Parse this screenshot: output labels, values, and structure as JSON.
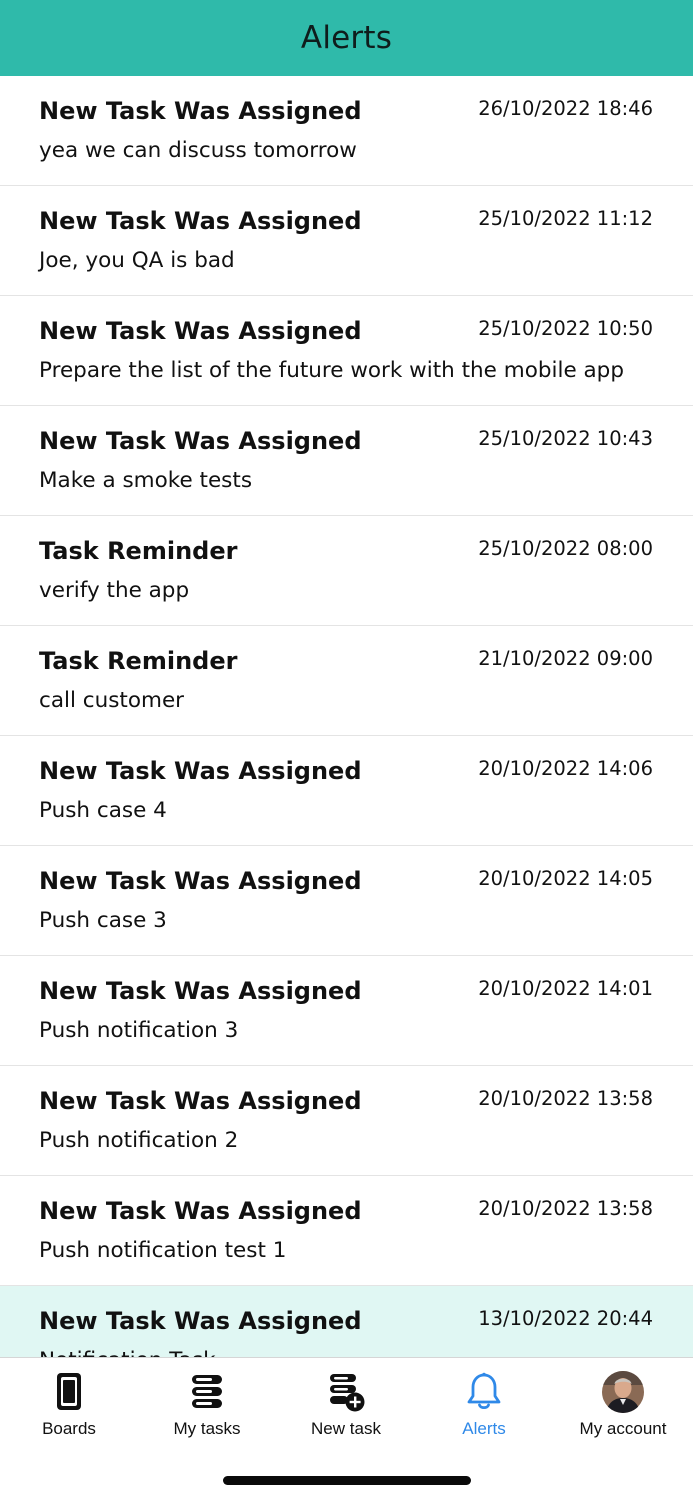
{
  "header": {
    "title": "Alerts"
  },
  "alerts": [
    {
      "title": "New Task Was Assigned",
      "time": "26/10/2022 18:46",
      "body": "yea we can discuss tomorrow"
    },
    {
      "title": "New Task Was Assigned",
      "time": "25/10/2022 11:12",
      "body": "Joe, you QA is bad"
    },
    {
      "title": "New Task Was Assigned",
      "time": "25/10/2022 10:50",
      "body": "Prepare the list of the future work with the mobile app"
    },
    {
      "title": "New Task Was Assigned",
      "time": "25/10/2022 10:43",
      "body": "Make a smoke tests"
    },
    {
      "title": "Task Reminder",
      "time": "25/10/2022 08:00",
      "body": "verify the app"
    },
    {
      "title": "Task Reminder",
      "time": "21/10/2022 09:00",
      "body": "call customer"
    },
    {
      "title": "New Task Was Assigned",
      "time": "20/10/2022 14:06",
      "body": "Push case 4"
    },
    {
      "title": "New Task Was Assigned",
      "time": "20/10/2022 14:05",
      "body": "Push case 3"
    },
    {
      "title": "New Task Was Assigned",
      "time": "20/10/2022 14:01",
      "body": "Push notification 3"
    },
    {
      "title": "New Task Was Assigned",
      "time": "20/10/2022 13:58",
      "body": "Push notification 2"
    },
    {
      "title": "New Task Was Assigned",
      "time": "20/10/2022 13:58",
      "body": "Push notification test 1"
    },
    {
      "title": "New Task Was Assigned",
      "time": "13/10/2022 20:44",
      "body": "Notification Task",
      "unread": true
    }
  ],
  "tabbar": {
    "tabs": [
      {
        "label": "Boards",
        "icon": "boards-icon"
      },
      {
        "label": "My tasks",
        "icon": "my-tasks-icon"
      },
      {
        "label": "New task",
        "icon": "new-task-icon"
      },
      {
        "label": "Alerts",
        "icon": "bell-icon",
        "active": true
      },
      {
        "label": "My account",
        "icon": "avatar"
      }
    ]
  },
  "colors": {
    "header_bg": "#2fbaaa",
    "active_tab": "#2f89e8",
    "unread_bg": "#e0f7f3"
  }
}
